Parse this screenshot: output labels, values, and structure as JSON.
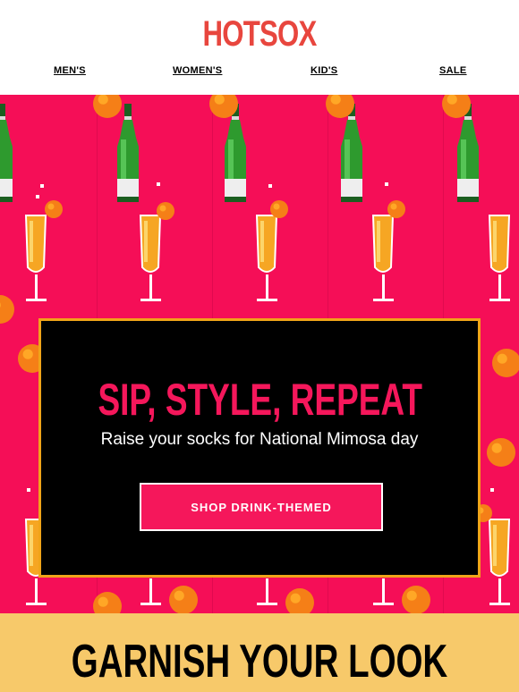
{
  "header": {
    "brand": "HOTSOX",
    "nav": [
      "MEN'S",
      "WOMEN'S",
      "KID'S",
      "SALE"
    ]
  },
  "hero": {
    "pattern_icons": [
      "champagne-bottle-icon",
      "mimosa-glass-icon",
      "orange-slice-icon"
    ],
    "headline": "SIP, STYLE, REPEAT",
    "subheadline": "Raise your socks for National Mimosa day",
    "cta_label": "SHOP DRINK-THEMED"
  },
  "section": {
    "title": "GARNISH YOUR LOOK"
  },
  "colors": {
    "brand": "#e8463e",
    "hero_bg": "#f50e57",
    "headline": "#f5175b",
    "card_border": "#f0a419",
    "section_bg": "#f7c96a"
  }
}
